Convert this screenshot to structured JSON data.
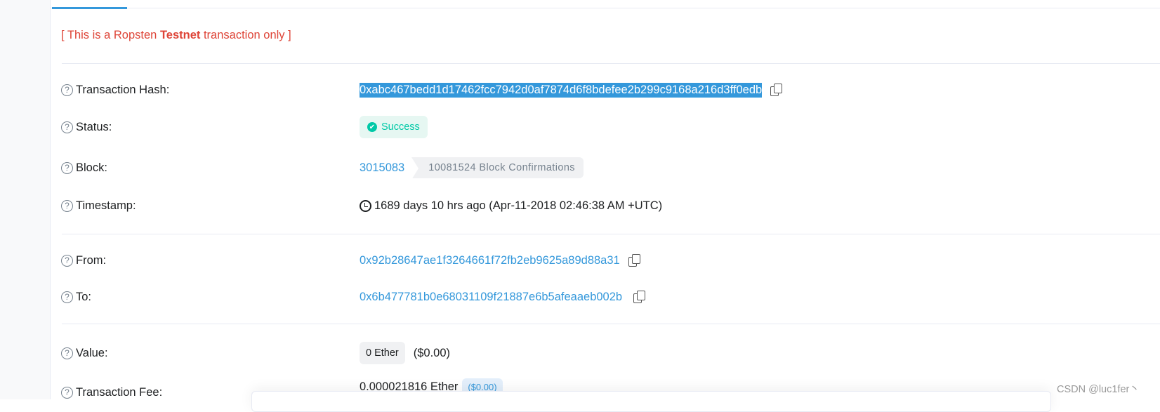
{
  "notice": {
    "prefix": "[ This is a Ropsten ",
    "bold": "Testnet",
    "suffix": " transaction only ]"
  },
  "rows": {
    "hash": {
      "label": "Transaction Hash:",
      "value": "0xabc467bedd1d17462fcc7942d0af7874d6f8bdefee2b299c9168a216d3ff0edb"
    },
    "status": {
      "label": "Status:",
      "value": "Success"
    },
    "block": {
      "label": "Block:",
      "value": "3015083",
      "confirmations": "10081524 Block Confirmations"
    },
    "timestamp": {
      "label": "Timestamp:",
      "value": "1689 days 10 hrs ago (Apr-11-2018 02:46:38 AM +UTC)"
    },
    "from": {
      "label": "From:",
      "value": "0x92b28647ae1f3264661f72fb2eb9625a89d88a31"
    },
    "to": {
      "label": "To:",
      "value": "0x6b477781b0e68031109f21887e6b5afeaaeb002b"
    },
    "value": {
      "label": "Value:",
      "ether": "0 Ether",
      "usd": "($0.00)"
    },
    "fee": {
      "label": "Transaction Fee:",
      "ether": "0.000021816 Ether",
      "usd": "($0.00)"
    }
  },
  "watermark": "CSDN @luc1fer丶",
  "colors": {
    "accent": "#3498db",
    "success": "#00c9a7",
    "warning": "#de4437"
  }
}
